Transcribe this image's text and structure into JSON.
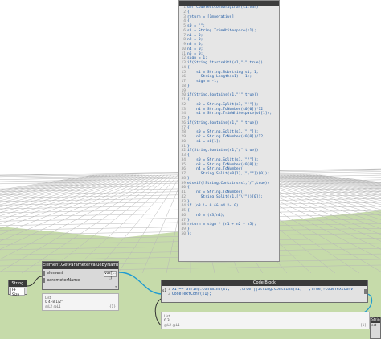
{
  "colors": {
    "sky": "#ffffff",
    "ground": "#c6dbaa",
    "grid": "#b7b7b7",
    "wire": "#1f9bd1",
    "node_header": "#3a3a3a",
    "code_text": "#1a57a3"
  },
  "code_node": {
    "lines": [
      {
        "n": "1",
        "t": "def CodeTextConv0riginal(s1:var)"
      },
      {
        "n": "2",
        "t": "{"
      },
      {
        "n": "3",
        "t": "return = [Imperative]"
      },
      {
        "n": "4",
        "t": "{"
      },
      {
        "n": "5",
        "t": "s0 = \"\";"
      },
      {
        "n": "6",
        "t": "s1 = String.TrimWhitespace(s1);"
      },
      {
        "n": "7",
        "t": "n1 = 0;"
      },
      {
        "n": "8",
        "t": "n2 = 0;"
      },
      {
        "n": "9",
        "t": "n3 = 0;"
      },
      {
        "n": "10",
        "t": "n4 = 0;"
      },
      {
        "n": "11",
        "t": "n5 = 0;"
      },
      {
        "n": "12",
        "t": "sign = 1;"
      },
      {
        "n": "13",
        "t": "if(String.StartsWith(s1,\"-\",true))"
      },
      {
        "n": "14",
        "t": "{"
      },
      {
        "n": "15",
        "t": "    s1 = String.Substring(s1, 1,"
      },
      {
        "n": "16",
        "t": "      String.Length(s1) - 1);"
      },
      {
        "n": "17",
        "t": "    sign = -1;"
      },
      {
        "n": "18",
        "t": "}"
      },
      {
        "n": "19",
        "t": ""
      },
      {
        "n": "20",
        "t": "if(String.Contains(s1,\"'\",true))"
      },
      {
        "n": "21",
        "t": "{"
      },
      {
        "n": "22",
        "t": "    s0 = String.Split(s1,[\"'\"]);"
      },
      {
        "n": "23",
        "t": "    n1 = String.ToNumber(s0[0])*12;"
      },
      {
        "n": "24",
        "t": "    s1 = String.TrimWhitespace(s0[1]);"
      },
      {
        "n": "25",
        "t": "}"
      },
      {
        "n": "26",
        "t": "if(String.Contains(s1,\" \",true))"
      },
      {
        "n": "27",
        "t": "{"
      },
      {
        "n": "28",
        "t": "    s0 = String.Split(s1,[\" \"]);"
      },
      {
        "n": "29",
        "t": "    n2 = String.ToNumber(s0[0])/12;"
      },
      {
        "n": "30",
        "t": "    s1 = s0[1];"
      },
      {
        "n": "31",
        "t": "}"
      },
      {
        "n": "32",
        "t": "if(String.Contains(s1,\"/\",true))"
      },
      {
        "n": "33",
        "t": "{"
      },
      {
        "n": "34",
        "t": "    s0 = String.Split(s1,[\"/\"]);"
      },
      {
        "n": "35",
        "t": "    n3 = String.ToNumber(s0[0]);"
      },
      {
        "n": "36",
        "t": "    n4 = String.ToNumber("
      },
      {
        "n": "37",
        "t": "      String.Split(s0[1],[\"\\\"\"])[0]);"
      },
      {
        "n": "38",
        "t": "}"
      },
      {
        "n": "39",
        "t": "elseif(!String.Contains(s1,\"/\",true))"
      },
      {
        "n": "40",
        "t": "{"
      },
      {
        "n": "41",
        "t": "    n2 = String.ToNumber("
      },
      {
        "n": "42",
        "t": "      String.Split(s1,[\"\\\"\"])[0]);"
      },
      {
        "n": "43",
        "t": "}"
      },
      {
        "n": "44",
        "t": "if (n3 != 0 && n4 != 0)"
      },
      {
        "n": "45",
        "t": "{"
      },
      {
        "n": "46",
        "t": "    n5 = (n3/n4);"
      },
      {
        "n": "47",
        "t": "}"
      },
      {
        "n": "48",
        "t": "return = sign * (n1 + n2 + n5);"
      },
      {
        "n": "49",
        "t": "}"
      },
      {
        "n": "50",
        "t": "};"
      }
    ]
  },
  "gpv_node": {
    "title": "Element.GetParameterValueByName",
    "port_element": "element",
    "port_parameter": "parameterName",
    "output_label": "var[]..[]"
  },
  "string_node": {
    "title": "String",
    "value": "FF Size"
  },
  "watch_left": {
    "line1": "List",
    "line2": "0  4'-8 1/2\"",
    "footer": "@L2 @L1",
    "count": "{1}"
  },
  "watch_lower": {
    "line1": "List",
    "line2": "0  3",
    "footer": "@L2 @L1",
    "count": "{1}"
  },
  "code_block": {
    "title": "Code Block",
    "input_label": "s1",
    "lines": [
      {
        "n": "1",
        "t": "x1 == String.Contains(s1,\"' \",true)||String.Contains(s1,\"'\",true)?CodeTextConv"
      },
      {
        "n": "2",
        "t": "CodeTextConv(s1);"
      }
    ]
  },
  "small_node": {
    "title": "String",
    "sub": "ect"
  }
}
